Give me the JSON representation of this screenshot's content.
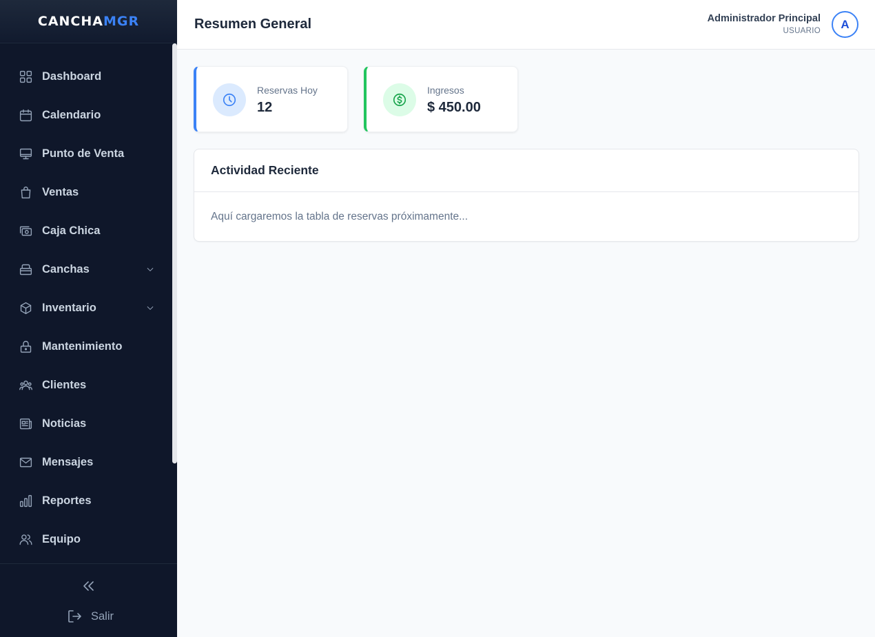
{
  "brand": {
    "part1": "CANCHA",
    "part2": "MGR"
  },
  "sidebar": {
    "items": [
      {
        "label": "Dashboard",
        "icon": "grid-icon"
      },
      {
        "label": "Calendario",
        "icon": "calendar-icon"
      },
      {
        "label": "Punto de Venta",
        "icon": "monitor-icon"
      },
      {
        "label": "Ventas",
        "icon": "shopping-bag-icon"
      },
      {
        "label": "Caja Chica",
        "icon": "cash-icon"
      },
      {
        "label": "Canchas",
        "icon": "court-icon",
        "expandable": true
      },
      {
        "label": "Inventario",
        "icon": "box-icon",
        "expandable": true
      },
      {
        "label": "Mantenimiento",
        "icon": "lock-icon"
      },
      {
        "label": "Clientes",
        "icon": "users-icon"
      },
      {
        "label": "Noticias",
        "icon": "newspaper-icon"
      },
      {
        "label": "Mensajes",
        "icon": "mail-icon"
      },
      {
        "label": "Reportes",
        "icon": "bar-chart-icon"
      },
      {
        "label": "Equipo",
        "icon": "team-icon"
      }
    ],
    "logout_label": "Salir"
  },
  "header": {
    "title": "Resumen General",
    "user_name": "Administrador Principal",
    "user_role": "USUARIO",
    "avatar_initial": "A"
  },
  "stats": [
    {
      "title": "Reservas Hoy",
      "value": "12",
      "icon": "clock-icon",
      "color": "#3b82f6"
    },
    {
      "title": "Ingresos",
      "value": "$ 450.00",
      "icon": "dollar-icon",
      "color": "#22c55e"
    }
  ],
  "activity": {
    "title": "Actividad Reciente",
    "placeholder": "Aquí cargaremos la tabla de reservas próximamente..."
  },
  "colors": {
    "sidebar_bg": "#0f172a",
    "accent": "#3b82f6",
    "success": "#22c55e"
  }
}
